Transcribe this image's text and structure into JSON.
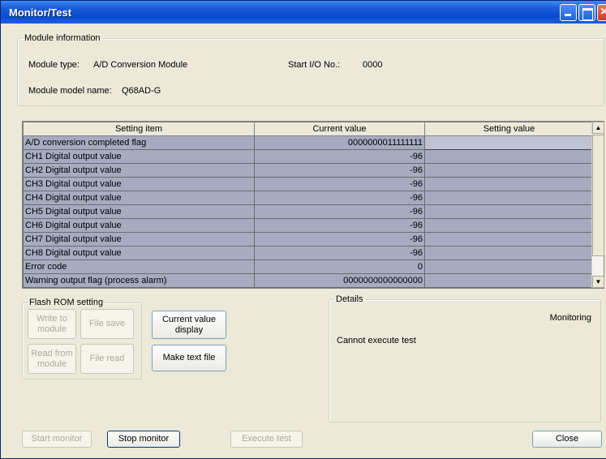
{
  "window": {
    "title": "Monitor/Test",
    "close_glyph": "×"
  },
  "module_info": {
    "legend": "Module information",
    "type_label": "Module type:",
    "type_value": "A/D Conversion Module",
    "start_io_label": "Start I/O No.:",
    "start_io_value": "0000",
    "model_label": "Module model name:",
    "model_value": "Q68AD-G"
  },
  "grid": {
    "headers": [
      "Setting item",
      "Current value",
      "Setting value"
    ],
    "rows": [
      {
        "item": "A/D conversion completed flag",
        "current": "0000000011111111",
        "setting": ""
      },
      {
        "item": "CH1 Digital output value",
        "current": "-96",
        "setting": ""
      },
      {
        "item": "CH2 Digital output value",
        "current": "-96",
        "setting": ""
      },
      {
        "item": "CH3 Digital output value",
        "current": "-96",
        "setting": ""
      },
      {
        "item": "CH4 Digital output value",
        "current": "-96",
        "setting": ""
      },
      {
        "item": "CH5 Digital output value",
        "current": "-96",
        "setting": ""
      },
      {
        "item": "CH6 Digital output value",
        "current": "-96",
        "setting": ""
      },
      {
        "item": "CH7 Digital output value",
        "current": "-96",
        "setting": ""
      },
      {
        "item": "CH8 Digital output value",
        "current": "-96",
        "setting": ""
      },
      {
        "item": "Error code",
        "current": "0",
        "setting": ""
      },
      {
        "item": "Warning output flag (process alarm)",
        "current": "0000000000000000",
        "setting": ""
      }
    ],
    "scroll_up": "▲",
    "scroll_down": "▼"
  },
  "flash_rom": {
    "legend": "Flash ROM setting",
    "write_to_module": "Write to module",
    "file_save": "File save",
    "read_from_module": "Read from module",
    "file_read": "File read"
  },
  "actions": {
    "current_value_display": "Current value display",
    "make_text_file": "Make text file"
  },
  "details": {
    "legend": "Details",
    "status": "Monitoring",
    "message": "Cannot execute test"
  },
  "footer": {
    "start_monitor": "Start monitor",
    "stop_monitor": "Stop monitor",
    "execute_test": "Execute test",
    "close": "Close"
  }
}
